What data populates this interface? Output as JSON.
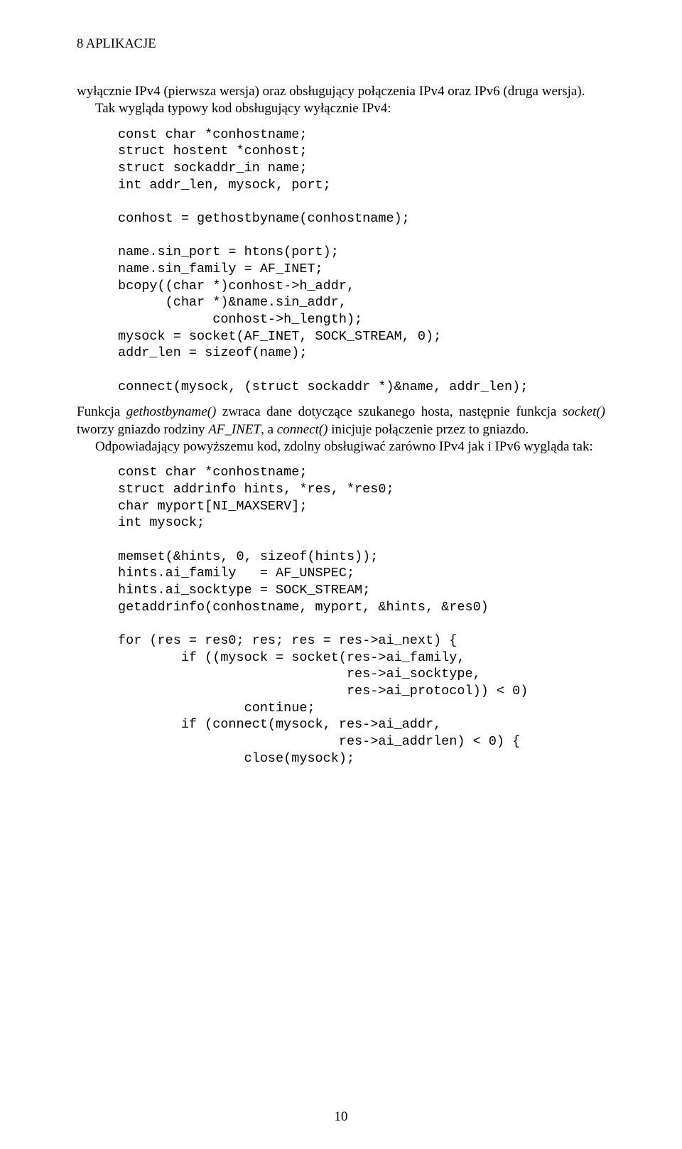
{
  "header": {
    "running_head": "8  APLIKACJE"
  },
  "para1": {
    "t1": "wyłącznie IPv4 (pierwsza wersja) oraz obsługujący połączenia IPv4 oraz IPv6 (druga wersja).",
    "t2": "Tak wygląda typowy kod obsługujący wyłącznie IPv4:"
  },
  "code1": "const char *conhostname;\nstruct hostent *conhost;\nstruct sockaddr_in name;\nint addr_len, mysock, port;\n\nconhost = gethostbyname(conhostname);\n\nname.sin_port = htons(port);\nname.sin_family = AF_INET;\nbcopy((char *)conhost->h_addr,\n      (char *)&name.sin_addr,\n            conhost->h_length);\nmysock = socket(AF_INET, SOCK_STREAM, 0);\naddr_len = sizeof(name);\n\nconnect(mysock, (struct sockaddr *)&name, addr_len);",
  "para2": {
    "seg1": "Funkcja ",
    "seg2_i": "gethostbyname()",
    "seg3": " zwraca dane dotyczące szukanego hosta, następnie funkcja ",
    "seg4_i": "socket()",
    "seg5": " tworzy gniazdo rodziny ",
    "seg6_i": "AF_INET",
    "seg7": ", a ",
    "seg8_i": "connect()",
    "seg9": " inicjuje połączenie przez to gniazdo."
  },
  "para3": "Odpowiadający powyższemu kod, zdolny obsługiwać zarówno IPv4 jak i IPv6 wygląda tak:",
  "code2": "const char *conhostname;\nstruct addrinfo hints, *res, *res0;\nchar myport[NI_MAXSERV];\nint mysock;\n\nmemset(&hints, 0, sizeof(hints));\nhints.ai_family   = AF_UNSPEC;\nhints.ai_socktype = SOCK_STREAM;\ngetaddrinfo(conhostname, myport, &hints, &res0)\n\nfor (res = res0; res; res = res->ai_next) {\n        if ((mysock = socket(res->ai_family,\n                             res->ai_socktype,\n                             res->ai_protocol)) < 0)\n                continue;\n        if (connect(mysock, res->ai_addr,\n                            res->ai_addrlen) < 0) {\n                close(mysock);",
  "page_number": "10"
}
